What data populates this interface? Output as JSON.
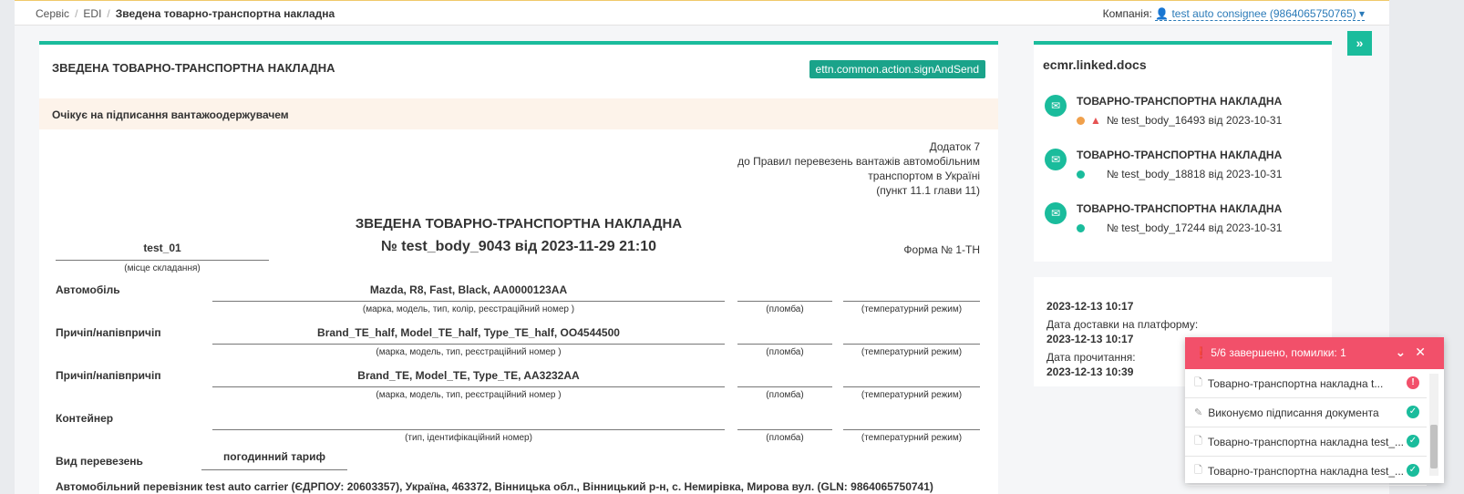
{
  "breadcrumb": {
    "items": [
      "Сервіс",
      "EDI"
    ],
    "current": "Зведена товарно-транспортна накладна",
    "sep": "/"
  },
  "company": {
    "label": "Компанія:",
    "value": "test auto consignee (9864065750765)"
  },
  "doc": {
    "header_title": "ЗВЕДЕНА ТОВАРНО-ТРАНСПОРТНА НАКЛАДНА",
    "sign_button": "ettn.common.action.signAndSend",
    "status": "Очікує на підписання вантажоодержувачем",
    "annex": [
      "Додаток 7",
      "до Правил перевезень вантажів автомобільним",
      "транспортом в Україні",
      "(пункт 11.1 глави 11)"
    ],
    "title": "ЗВЕДЕНА ТОВАРНО-ТРАНСПОРТНА НАКЛАДНА",
    "number": "№ test_body_9043 від 2023-11-29 21:10",
    "place_value": "test_01",
    "place_caption": "(місце складання)",
    "form_no": "Форма № 1-ТН",
    "seal_caption": "(пломба)",
    "temp_caption": "(температурний режим)",
    "rows": [
      {
        "label": "Автомобіль",
        "value": "Mazda, R8, Fast, Black, AA0000123AA",
        "caption": "(марка, модель, тип, колір, реєстраційний номер )"
      },
      {
        "label": "Причіп/напівпричіп",
        "value": "Brand_TE_half, Model_TE_half, Type_TE_half, OO4544500",
        "caption": "(марка, модель, тип, реєстраційний номер )"
      },
      {
        "label": "Причіп/напівпричіп",
        "value": "Brand_TE, Model_TE, Type_TE, AA3232AA",
        "caption": "(марка, модель, тип, реєстраційний номер )"
      },
      {
        "label": "Контейнер",
        "value": "",
        "caption": "(тип, ідентифікаційний номер)"
      }
    ],
    "transport_label": "Вид перевезень",
    "transport_value": "погодинний тариф",
    "cut_text": "Автомобільний перевізник          test auto carrier (ЄДРПОУ: 20603357), Україна, 463372, Вінницька обл., Вінницький р-н, с. Немирівка, Мирова вул. (GLN: 9864065750741)"
  },
  "linked": {
    "title": "ecmr.linked.docs",
    "items": [
      {
        "name": "ТОВАРНО-ТРАНСПОРТНА НАКЛАДНА",
        "ref": "№ test_body_16493 від 2023-10-31",
        "dot": "#f0a04b",
        "warn": true
      },
      {
        "name": "ТОВАРНО-ТРАНСПОРТНА НАКЛАДНА",
        "ref": "№ test_body_18818 від 2023-10-31",
        "dot": "#1abc9c",
        "warn": false
      },
      {
        "name": "ТОВАРНО-ТРАНСПОРТНА НАКЛАДНА",
        "ref": "№ test_body_17244 від 2023-10-31",
        "dot": "#1abc9c",
        "warn": false
      }
    ]
  },
  "dates": {
    "created": "2023-12-13 10:17",
    "delivery_label": "Дата доставки на платформу:",
    "delivery": "2023-12-13 10:17",
    "read_label": "Дата прочитання:",
    "read": "2023-12-13 10:39"
  },
  "toast": {
    "header": "5/6 завершено, помилки: 1",
    "items": [
      {
        "text": "Товарно-транспортна накладна t...",
        "icon": "file-icon",
        "status": "error"
      },
      {
        "text": "Виконуємо підписання документа",
        "icon": "pencil-icon",
        "status": "ok"
      },
      {
        "text": "Товарно-транспортна накладна test_...",
        "icon": "file-icon",
        "status": "ok"
      },
      {
        "text": "Товарно-транспортна накладна test_...",
        "icon": "file-icon",
        "status": "ok"
      }
    ]
  },
  "colors": {
    "accent": "#1abc9c",
    "error": "#f2506a",
    "warn": "#f0a04b"
  }
}
